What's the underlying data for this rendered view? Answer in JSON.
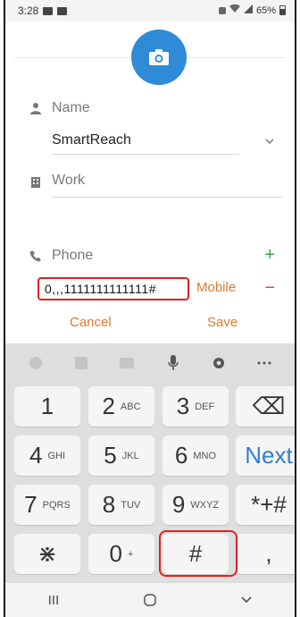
{
  "status_bar": {
    "time": "3:28",
    "battery": "65%"
  },
  "form": {
    "name_label": "Name",
    "name_value": "SmartReach",
    "work_label": "Work",
    "phone_label": "Phone",
    "phone_value": "0,,,1111111111111#",
    "phone_type": "Mobile",
    "add_symbol": "+",
    "remove_symbol": "−"
  },
  "actions": {
    "cancel": "Cancel",
    "save": "Save"
  },
  "keyboard": {
    "rows": [
      [
        {
          "main": "1",
          "sub": ""
        },
        {
          "main": "2",
          "sub": "ABC"
        },
        {
          "main": "3",
          "sub": "DEF"
        },
        {
          "main": "⌫",
          "sub": ""
        }
      ],
      [
        {
          "main": "4",
          "sub": "GHI"
        },
        {
          "main": "5",
          "sub": "JKL"
        },
        {
          "main": "6",
          "sub": "MNO"
        },
        {
          "main": "Next",
          "sub": ""
        }
      ],
      [
        {
          "main": "7",
          "sub": "PQRS"
        },
        {
          "main": "8",
          "sub": "TUV"
        },
        {
          "main": "9",
          "sub": "WXYZ"
        },
        {
          "main": "*+#",
          "sub": ""
        }
      ],
      [
        {
          "main": "⋇",
          "sub": ""
        },
        {
          "main": "0",
          "sub": "+"
        },
        {
          "main": "#",
          "sub": ""
        },
        {
          "main": ",",
          "sub": ""
        }
      ]
    ],
    "toolbar_icons": [
      "emoji-icon",
      "sticker-icon",
      "gif-icon",
      "microphone-icon",
      "gear-icon",
      "more-icon"
    ]
  },
  "navbar": {
    "icons": [
      "recents-icon",
      "home-icon",
      "back-icon"
    ]
  },
  "colors": {
    "accent": "#e07a2c",
    "avatar": "#2f8ad8",
    "highlight": "#e02020",
    "add": "#3aa64a",
    "next": "#2f7fd3"
  }
}
